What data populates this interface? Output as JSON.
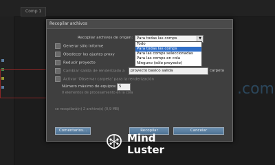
{
  "app": {
    "comp_tab": "Comp 1"
  },
  "background": {
    "partial_text": ".com"
  },
  "dialog": {
    "title": "Recopilar archivos",
    "collect_label": "Recopilar archivos de origen:",
    "collect_select": {
      "value": "Para todas las comps"
    },
    "dropdown_options": [
      {
        "label": "Todo",
        "selected": false
      },
      {
        "label": "Para todas las comps",
        "selected": true
      },
      {
        "label": "Para las comps seleccionadas",
        "selected": false
      },
      {
        "label": "Para las comps en cola",
        "selected": false
      },
      {
        "label": "Ninguno (sólo proyecto)",
        "selected": false
      }
    ],
    "options": [
      {
        "label": "Generar sólo informe",
        "checked": false,
        "enabled": true
      },
      {
        "label": "Obedecer los ajustes proxy",
        "checked": false,
        "enabled": true
      },
      {
        "label": "Reducir proyecto",
        "checked": false,
        "enabled": true
      },
      {
        "label": "Cambiar salida de renderizado a",
        "checked": false,
        "enabled": false
      },
      {
        "label": "Activar 'Observar carpeta' para la renderización",
        "checked": false,
        "enabled": false
      }
    ],
    "render_output_field": "proyecto basico salida",
    "render_output_suffix": "carpeta",
    "max_machines_label": "Número máximo de equipos:",
    "max_machines_value": "5",
    "note": "0 elementos de procesamiento en la cola",
    "summary": "se recopilará(n) 2 archivo(s) (0,9 MB)",
    "buttons": {
      "comments": "Comentarios...",
      "collect": "Recopilar",
      "cancel": "Cancelar"
    }
  },
  "brand": {
    "line1": "Mind",
    "line2": "Luster"
  },
  "colors": {
    "accent": "#2f6ec7",
    "button": "#5d82a4",
    "dialog_bg": "#3f3f3f"
  }
}
